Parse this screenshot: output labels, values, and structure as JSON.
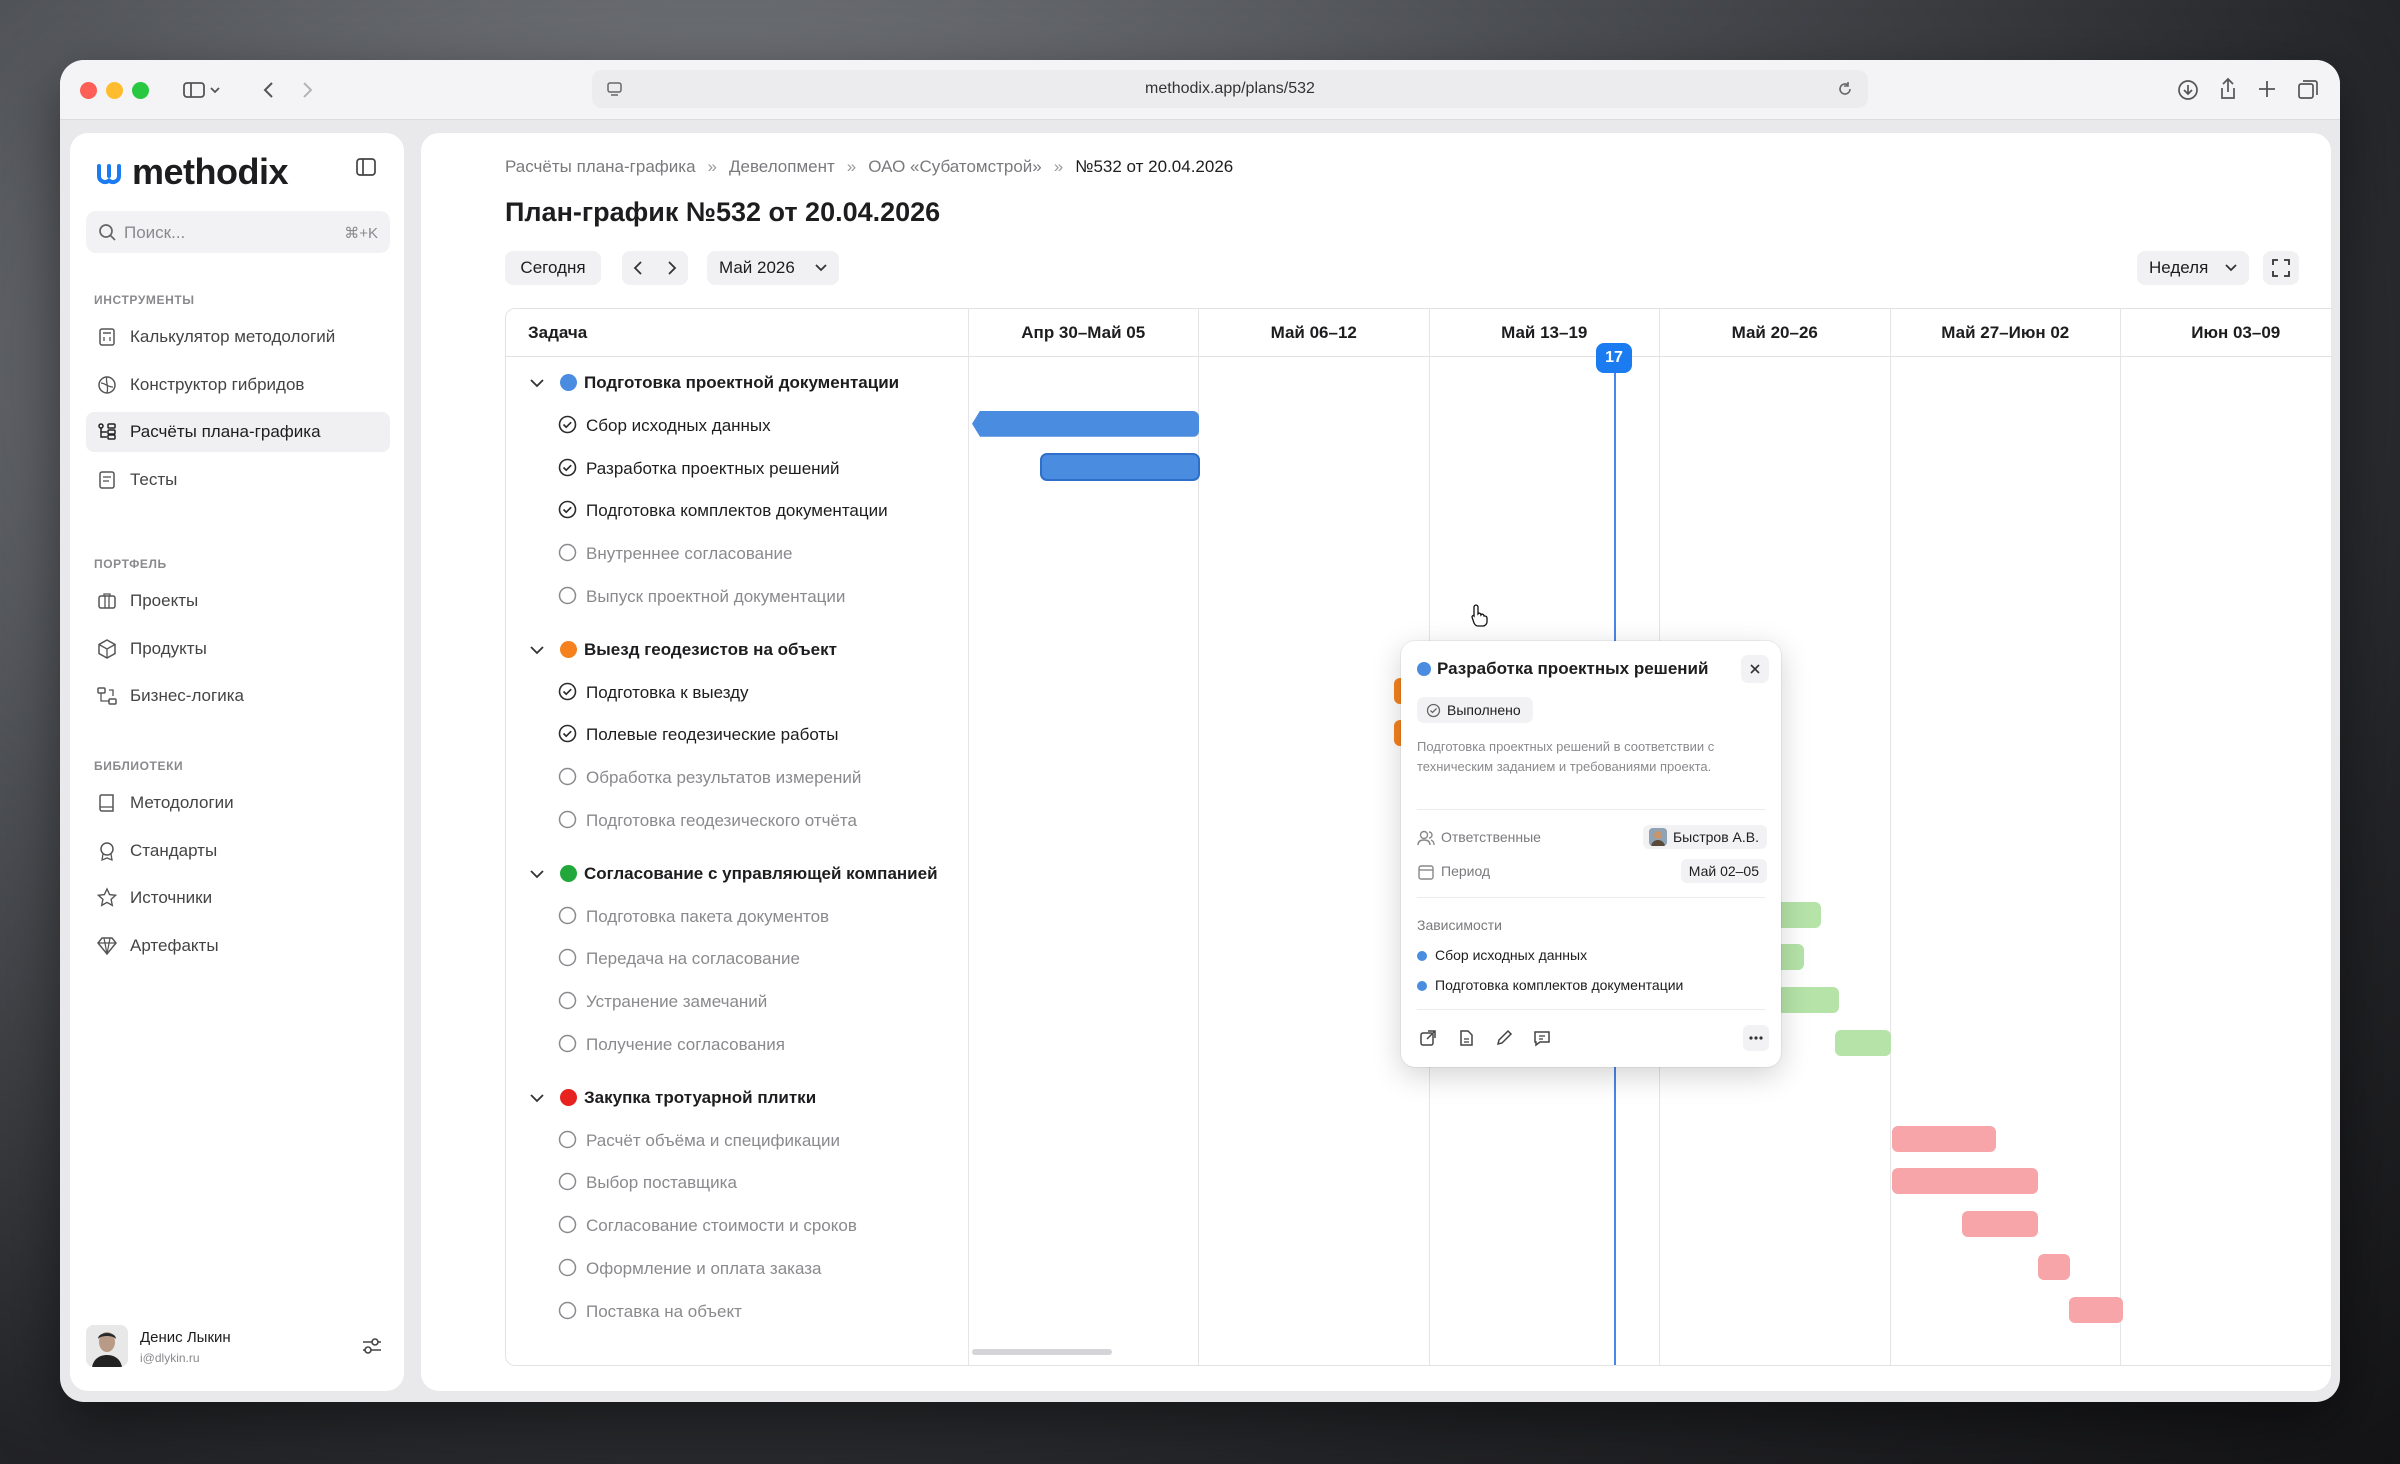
{
  "browser": {
    "url": "methodix.app/plans/532"
  },
  "sidebar": {
    "logo": "methodix",
    "search": {
      "placeholder": "Поиск...",
      "shortcut": "⌘+K"
    },
    "sections": [
      {
        "title": "ИНСТРУМЕНТЫ",
        "items": [
          {
            "label": "Калькулятор методологий",
            "icon": "calculator-icon"
          },
          {
            "label": "Конструктор гибридов",
            "icon": "hybrid-icon"
          },
          {
            "label": "Расчёты плана-графика",
            "icon": "tree-icon",
            "active": true
          },
          {
            "label": "Тесты",
            "icon": "test-icon"
          }
        ]
      },
      {
        "title": "ПОРТФЕЛЬ",
        "items": [
          {
            "label": "Проекты",
            "icon": "briefcase-icon"
          },
          {
            "label": "Продукты",
            "icon": "cube-icon"
          },
          {
            "label": "Бизнес-логика",
            "icon": "flow-icon"
          }
        ]
      },
      {
        "title": "БИБЛИОТЕКИ",
        "items": [
          {
            "label": "Методологии",
            "icon": "book-icon"
          },
          {
            "label": "Стандарты",
            "icon": "award-icon"
          },
          {
            "label": "Источники",
            "icon": "star-icon"
          },
          {
            "label": "Артефакты",
            "icon": "gem-icon"
          }
        ]
      }
    ],
    "user": {
      "name": "Денис Лыкин",
      "email": "i@dlykin.ru"
    }
  },
  "main": {
    "breadcrumbs": [
      "Расчёты плана-графика",
      "Девелопмент",
      "ОАО «Субатомстрой»",
      "№532 от 20.04.2026"
    ],
    "title": "План-график №532 от 20.04.2026",
    "toolbar": {
      "today": "Сегодня",
      "month": "Май 2026",
      "scale": "Неделя"
    },
    "task_header": "Задача",
    "weeks": [
      "Апр 30–Май 05",
      "Май 06–12",
      "Май 13–19",
      "Май 20–26",
      "Май 27–Июн 02",
      "Июн 03–09"
    ],
    "today_label": "17",
    "groups": [
      {
        "label": "Подготовка проектной документации",
        "color": "#4a8ce0",
        "tasks": [
          {
            "label": "Сбор исходных данных",
            "done": true
          },
          {
            "label": "Разработка проектных решений",
            "done": true
          },
          {
            "label": "Подготовка комплектов документации",
            "done": true
          },
          {
            "label": "Внутреннее согласование",
            "done": false
          },
          {
            "label": "Выпуск проектной документации",
            "done": false
          }
        ]
      },
      {
        "label": "Выезд геодезистов на объект",
        "color": "#f5821f",
        "tasks": [
          {
            "label": "Подготовка к выезду",
            "done": true
          },
          {
            "label": "Полевые геодезические работы",
            "done": true
          },
          {
            "label": "Обработка результатов измерений",
            "done": false
          },
          {
            "label": "Подготовка геодезического отчёта",
            "done": false
          }
        ]
      },
      {
        "label": "Согласование с управляющей компанией",
        "color": "#22a83a",
        "tasks": [
          {
            "label": "Подготовка пакета документов",
            "done": false
          },
          {
            "label": "Передача на согласование",
            "done": false
          },
          {
            "label": "Устранение замечаний",
            "done": false
          },
          {
            "label": "Получение согласования",
            "done": false
          }
        ]
      },
      {
        "label": "Закупка тротуарной плитки",
        "color": "#e8231f",
        "tasks": [
          {
            "label": "Расчёт объёма и спецификации",
            "done": false
          },
          {
            "label": "Выбор поставщика",
            "done": false
          },
          {
            "label": "Согласование стоимости и сроков",
            "done": false
          },
          {
            "label": "Оформление и оплата заказа",
            "done": false
          },
          {
            "label": "Поставка на объект",
            "done": false
          }
        ]
      }
    ],
    "popover": {
      "title": "Разработка проектных решений",
      "status": "Выполнено",
      "description": "Подготовка проектных решений в соответствии с техническим заданием и требованиями проекта.",
      "responsible_label": "Ответственные",
      "responsible_value": "Быстров А.В.",
      "period_label": "Период",
      "period_value": "Май 02–05",
      "deps_label": "Зависимости",
      "deps": [
        "Сбор исходных данных",
        "Подготовка комплектов документации"
      ]
    }
  }
}
